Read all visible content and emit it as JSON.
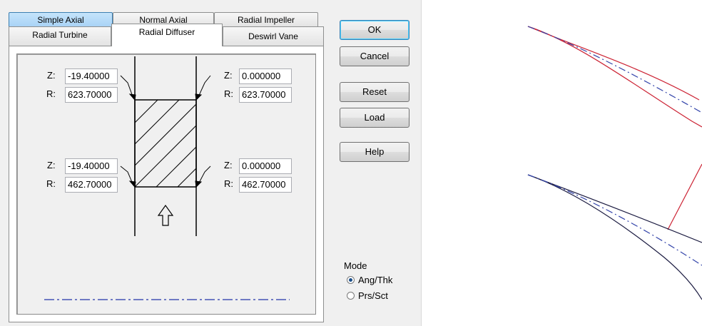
{
  "tabs": {
    "row1": [
      "Simple Axial",
      "Normal Axial",
      "Radial Impeller"
    ],
    "row2": [
      "Radial Turbine",
      "Radial Diffuser",
      "Deswirl Vane"
    ],
    "active": "Radial Diffuser"
  },
  "fields": {
    "top_left": {
      "z_label": "Z:",
      "z_value": "-19.40000",
      "r_label": "R:",
      "r_value": "623.70000"
    },
    "top_right": {
      "z_label": "Z:",
      "z_value": "0.000000",
      "r_label": "R:",
      "r_value": "623.70000"
    },
    "bottom_left": {
      "z_label": "Z:",
      "z_value": "-19.40000",
      "r_label": "R:",
      "r_value": "462.70000"
    },
    "bottom_right": {
      "z_label": "Z:",
      "z_value": "0.000000",
      "r_label": "R:",
      "r_value": "462.70000"
    }
  },
  "buttons": {
    "ok": "OK",
    "cancel": "Cancel",
    "reset": "Reset",
    "load": "Load",
    "help": "Help"
  },
  "mode": {
    "label": "Mode",
    "options": [
      "Ang/Thk",
      "Prs/Sct"
    ],
    "selected": "Ang/Thk"
  },
  "colors": {
    "pressure_side": "#cc2233",
    "suction_side": "#1a1a40",
    "camber": "#3344aa",
    "axis_line": "#2233aa"
  }
}
